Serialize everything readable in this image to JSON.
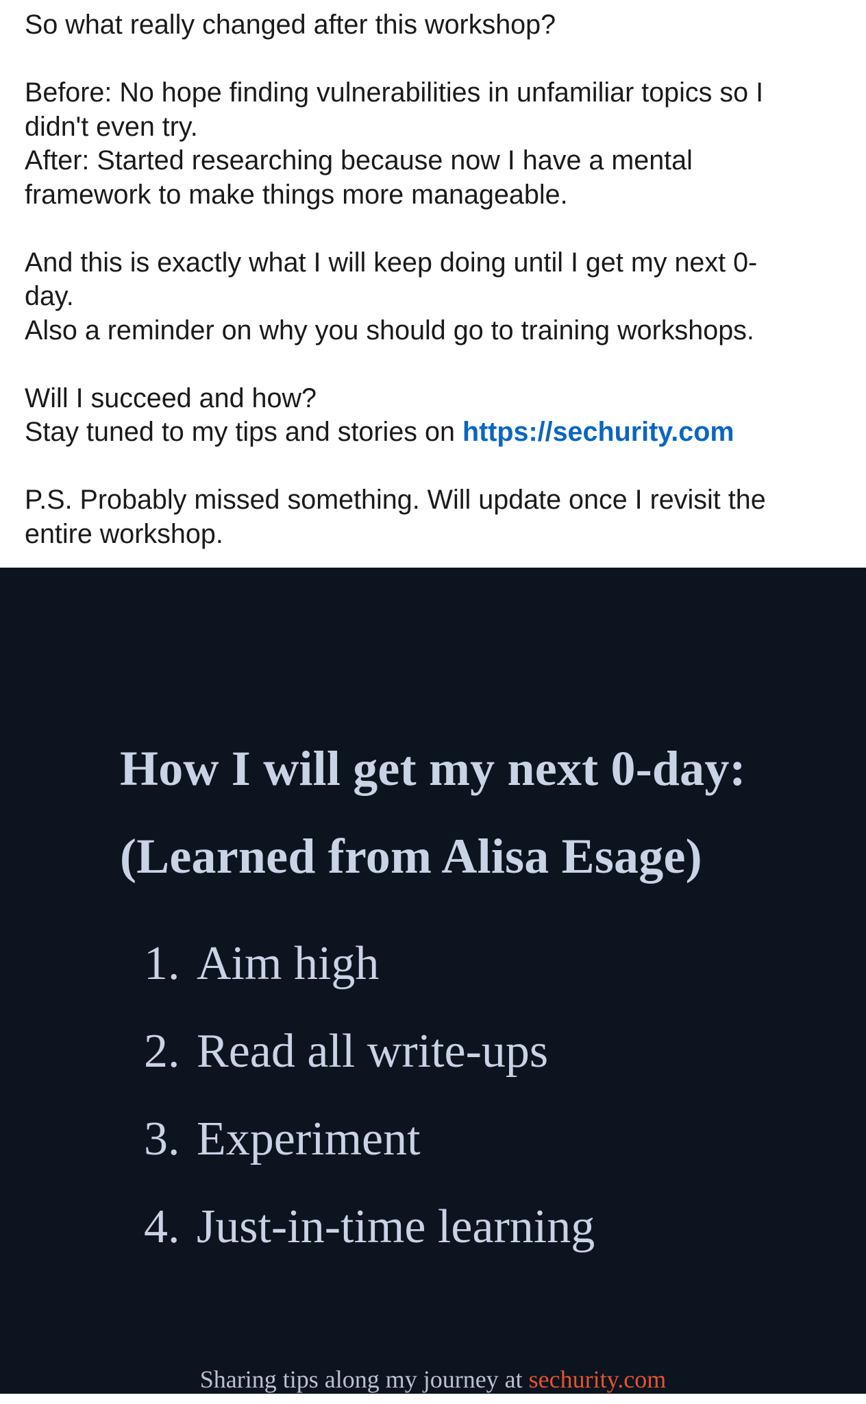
{
  "post": {
    "question": "So what really changed after this workshop?",
    "before_line1": "Before: No hope finding vulnerabilities in unfamiliar topics so I",
    "before_line2": "didn't even try.",
    "after_line1": "After: Started researching because now I have a mental",
    "after_line2": "framework to make things more manageable.",
    "keep_line1": "And this is exactly what I will keep doing until I get my next 0-",
    "keep_line2": "day.",
    "reminder": "Also a reminder on why you should go to training workshops.",
    "succeed": "Will I succeed and how?",
    "stay_tuned_prefix": "Stay tuned to my tips and stories on ",
    "link_text": "https://sechurity.com",
    "ps_line1": "P.S. Probably missed something. Will update once I revisit the",
    "ps_line2": "entire workshop.",
    "link_color": "#0a66c2"
  },
  "image": {
    "background_color": "#0c1420",
    "title_line1": "How I will get my next 0-day:",
    "title_line2": "(Learned from Alisa Esage)",
    "steps": [
      {
        "num": "1.",
        "text": "Aim high"
      },
      {
        "num": "2.",
        "text": "Read all write-ups"
      },
      {
        "num": "3.",
        "text": "Experiment"
      },
      {
        "num": "4.",
        "text": "Just-in-time learning"
      }
    ],
    "footer_prefix": "Sharing tips along my journey at ",
    "footer_link": "sechurity.com",
    "footer_link_color": "#e5532d"
  }
}
